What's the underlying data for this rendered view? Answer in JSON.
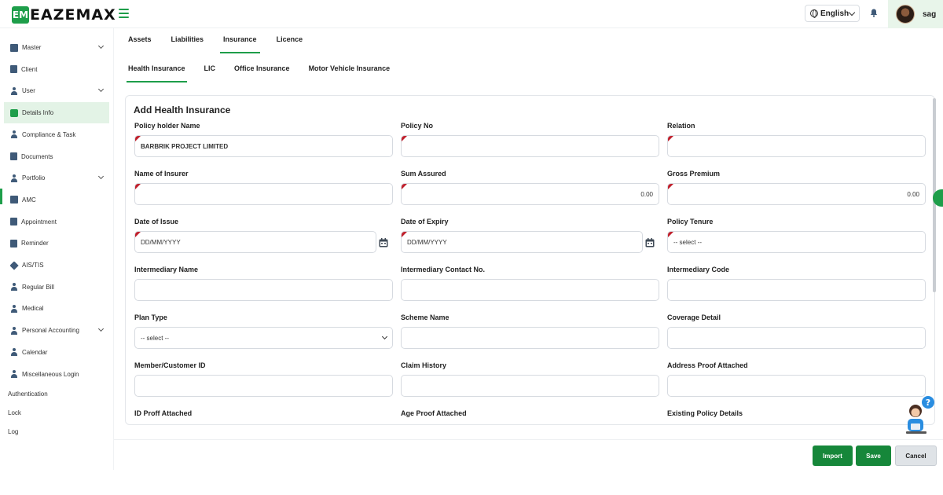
{
  "app": {
    "logo_mark": "EM",
    "logo_text": "EAZEMAX",
    "language": "English",
    "username": "sag"
  },
  "sidebar": {
    "items": [
      {
        "label": "Master",
        "icon": "box-icon",
        "caret": true
      },
      {
        "label": "Client",
        "icon": "document-icon",
        "caret": false
      },
      {
        "label": "User",
        "icon": "user-icon",
        "caret": true
      },
      {
        "label": "Details Info",
        "icon": "info-icon",
        "caret": false,
        "active": true
      },
      {
        "label": "Compliance & Task",
        "icon": "gender-icon",
        "caret": false
      },
      {
        "label": "Documents",
        "icon": "folder-icon",
        "caret": false
      },
      {
        "label": "Portfolio",
        "icon": "person-icon",
        "caret": true
      },
      {
        "label": "AMC",
        "icon": "settings-icon",
        "caret": false
      },
      {
        "label": "Appointment",
        "icon": "calendar-doc-icon",
        "caret": false
      },
      {
        "label": "Reminder",
        "icon": "note-icon",
        "caret": false
      },
      {
        "label": "AIS/TIS",
        "icon": "tag-icon",
        "caret": false
      },
      {
        "label": "Regular Bill",
        "icon": "user-edit-icon",
        "caret": false
      },
      {
        "label": "Medical",
        "icon": "user-edit-icon",
        "caret": false
      },
      {
        "label": "Personal Accounting",
        "icon": "user-edit-icon",
        "caret": true
      },
      {
        "label": "Calendar",
        "icon": "user-edit-icon",
        "caret": false
      },
      {
        "label": "Miscellaneous Login",
        "icon": "user-edit-icon",
        "caret": false
      }
    ],
    "plain_items": [
      "Authentication",
      "Lock",
      "Log"
    ]
  },
  "tabs_primary": [
    "Assets",
    "Liabilities",
    "Insurance",
    "Licence"
  ],
  "tabs_primary_active": "Insurance",
  "tabs_secondary": [
    "Health Insurance",
    "LIC",
    "Office Insurance",
    "Motor Vehicle Insurance"
  ],
  "tabs_secondary_active": "Health Insurance",
  "form": {
    "title": "Add Health Insurance",
    "fields": [
      {
        "label": "Policy holder Name",
        "value": "BARBRIK PROJECT LIMITED",
        "type": "text",
        "required": true
      },
      {
        "label": "Policy No",
        "value": "",
        "type": "text",
        "required": true
      },
      {
        "label": "Relation",
        "value": "",
        "type": "text",
        "required": true
      },
      {
        "label": "Name of Insurer",
        "value": "",
        "type": "text",
        "required": true
      },
      {
        "label": "Sum Assured",
        "value": "0.00",
        "type": "number",
        "required": true
      },
      {
        "label": "Gross Premium",
        "value": "0.00",
        "type": "number",
        "required": true
      },
      {
        "label": "Date of Issue",
        "value": "DD/MM/YYYY",
        "type": "date",
        "required": true
      },
      {
        "label": "Date of Expiry",
        "value": "DD/MM/YYYY",
        "type": "date",
        "required": true
      },
      {
        "label": "Policy Tenure",
        "value": "-- select --",
        "type": "select-plain",
        "required": true
      },
      {
        "label": "Intermediary Name",
        "value": "",
        "type": "text",
        "required": false
      },
      {
        "label": "Intermediary Contact No.",
        "value": "",
        "type": "text",
        "required": false
      },
      {
        "label": "Intermediary Code",
        "value": "",
        "type": "text",
        "required": false
      },
      {
        "label": "Plan Type",
        "value": "-- select --",
        "type": "select",
        "required": false
      },
      {
        "label": "Scheme Name",
        "value": "",
        "type": "text",
        "required": false
      },
      {
        "label": "Coverage Detail",
        "value": "",
        "type": "text",
        "required": false
      },
      {
        "label": "Member/Customer ID",
        "value": "",
        "type": "text",
        "required": false
      },
      {
        "label": "Claim History",
        "value": "",
        "type": "text",
        "required": false
      },
      {
        "label": "Address Proof Attached",
        "value": "",
        "type": "text",
        "required": false
      },
      {
        "label": "ID Proff Attached",
        "value": "",
        "type": "text",
        "required": false
      },
      {
        "label": "Age Proof Attached",
        "value": "",
        "type": "text",
        "required": false
      },
      {
        "label": "Existing Policy Details",
        "value": "",
        "type": "text",
        "required": false
      }
    ]
  },
  "buttons": {
    "import": "Import",
    "save": "Save",
    "cancel": "Cancel"
  },
  "colors": {
    "brand_green": "#1e9e4a",
    "button_green": "#16873a",
    "required_marker": "#c0202c",
    "active_sidebar_bg": "#e3f3e6"
  }
}
